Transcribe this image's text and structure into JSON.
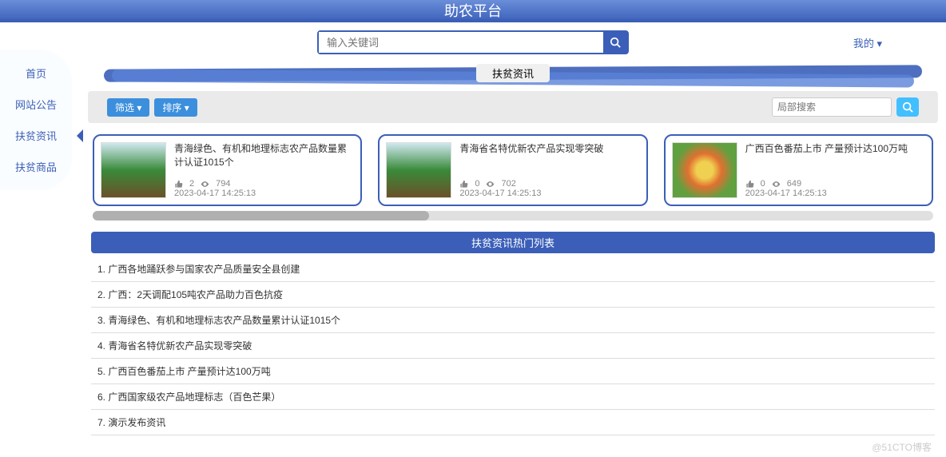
{
  "header": {
    "title": "助农平台"
  },
  "search": {
    "placeholder": "输入关键词"
  },
  "my_link": "我的 ▾",
  "sidebar": {
    "items": [
      {
        "label": "首页"
      },
      {
        "label": "网站公告"
      },
      {
        "label": "扶贫资讯"
      },
      {
        "label": "扶贫商品"
      }
    ],
    "active_index": 2
  },
  "section_title": "扶贫资讯",
  "filter": {
    "btn1": "筛选 ▾",
    "btn2": "排序 ▾"
  },
  "local_search": {
    "placeholder": "局部搜索"
  },
  "cards": [
    {
      "title": "青海绿色、有机和地理标志农产品数量累计认证1015个",
      "likes": "2",
      "views": "794",
      "date": "2023-04-17 14:25:13",
      "img": "landscape"
    },
    {
      "title": "青海省名特优新农产品实现零突破",
      "likes": "0",
      "views": "702",
      "date": "2023-04-17 14:25:13",
      "img": "landscape"
    },
    {
      "title": "广西百色番茄上市 产量预计达100万吨",
      "likes": "0",
      "views": "649",
      "date": "2023-04-17 14:25:13",
      "img": "fruit"
    }
  ],
  "hot_header": "扶贫资讯热门列表",
  "hot_list": [
    "1. 广西各地踊跃参与国家农产品质量安全县创建",
    "2. 广西：2天调配105吨农产品助力百色抗疫",
    "3. 青海绿色、有机和地理标志农产品数量累计认证1015个",
    "4. 青海省名特优新农产品实现零突破",
    "5. 广西百色番茄上市 产量预计达100万吨",
    "6. 广西国家级农产品地理标志（百色芒果）",
    "7. 演示发布资讯"
  ],
  "watermark": "@51CTO博客"
}
